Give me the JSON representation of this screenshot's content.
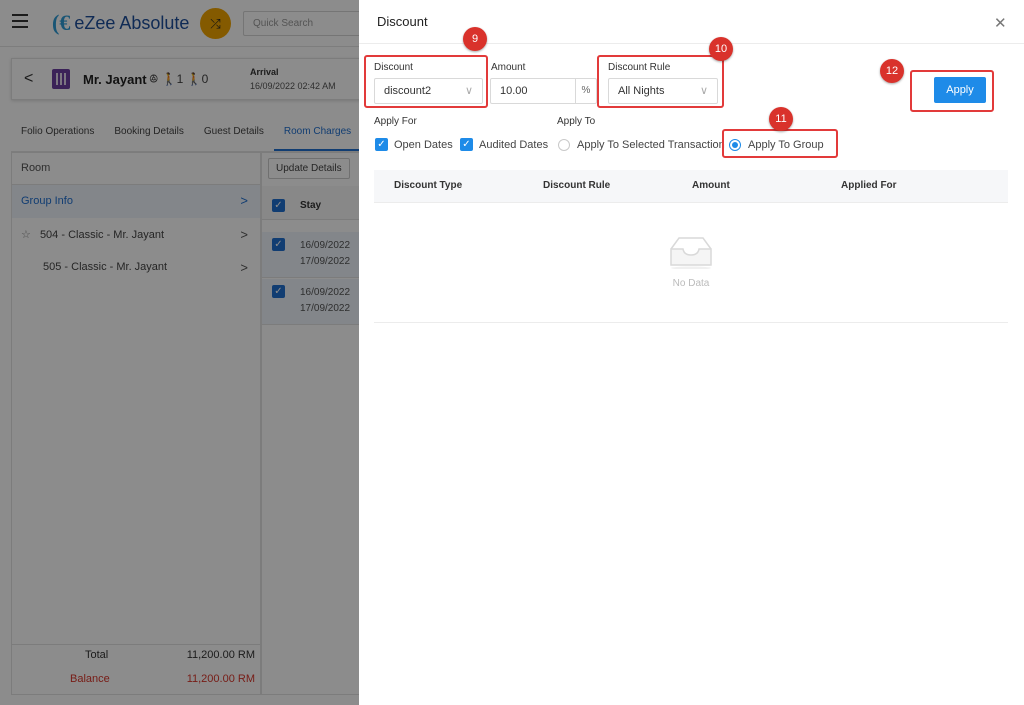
{
  "app": {
    "logo_text": "eZee Absolute",
    "quick_search_placeholder": "Quick Search"
  },
  "guest": {
    "name": "Mr. Jayant",
    "pax": "ꔮ 🚶1 🚶0",
    "arrival_label": "Arrival",
    "arrival_value": "16/09/2022 02:42 AM"
  },
  "tabs": [
    "Folio Operations",
    "Booking Details",
    "Guest Details",
    "Room Charges"
  ],
  "left_panel": {
    "header": "Room",
    "group_info": "Group Info",
    "rooms": [
      "504 - Classic - Mr. Jayant",
      "505 - Classic - Mr. Jayant"
    ],
    "total_label": "Total",
    "total_value": "11,200.00 RM",
    "balance_label": "Balance",
    "balance_value": "11,200.00 RM"
  },
  "mid_panel": {
    "update_button": "Update Details",
    "column": "Stay",
    "rows": [
      {
        "from": "16/09/2022",
        "to": "17/09/2022"
      },
      {
        "from": "16/09/2022",
        "to": "17/09/2022"
      }
    ]
  },
  "drawer": {
    "title": "Discount",
    "discount_label": "Discount",
    "discount_value": "discount2",
    "amount_label": "Amount",
    "amount_value": "10.00",
    "amount_unit": "%",
    "rule_label": "Discount Rule",
    "rule_value": "All Nights",
    "apply_button": "Apply",
    "apply_for_label": "Apply For",
    "open_dates": "Open Dates",
    "audited_dates": "Audited Dates",
    "apply_to_label": "Apply To",
    "apply_selected": "Apply To Selected Transaction",
    "apply_group": "Apply To Group",
    "table_headers": [
      "Discount Type",
      "Discount Rule",
      "Amount",
      "Applied For"
    ],
    "empty_text": "No Data"
  },
  "annotations": [
    "9",
    "10",
    "11",
    "12"
  ],
  "colors": {
    "primary": "#1e8be8",
    "annotation": "#d9322b",
    "balance": "#d9362b",
    "logo_blue": "#1e4f9c",
    "shuffle": "#f1a400"
  }
}
